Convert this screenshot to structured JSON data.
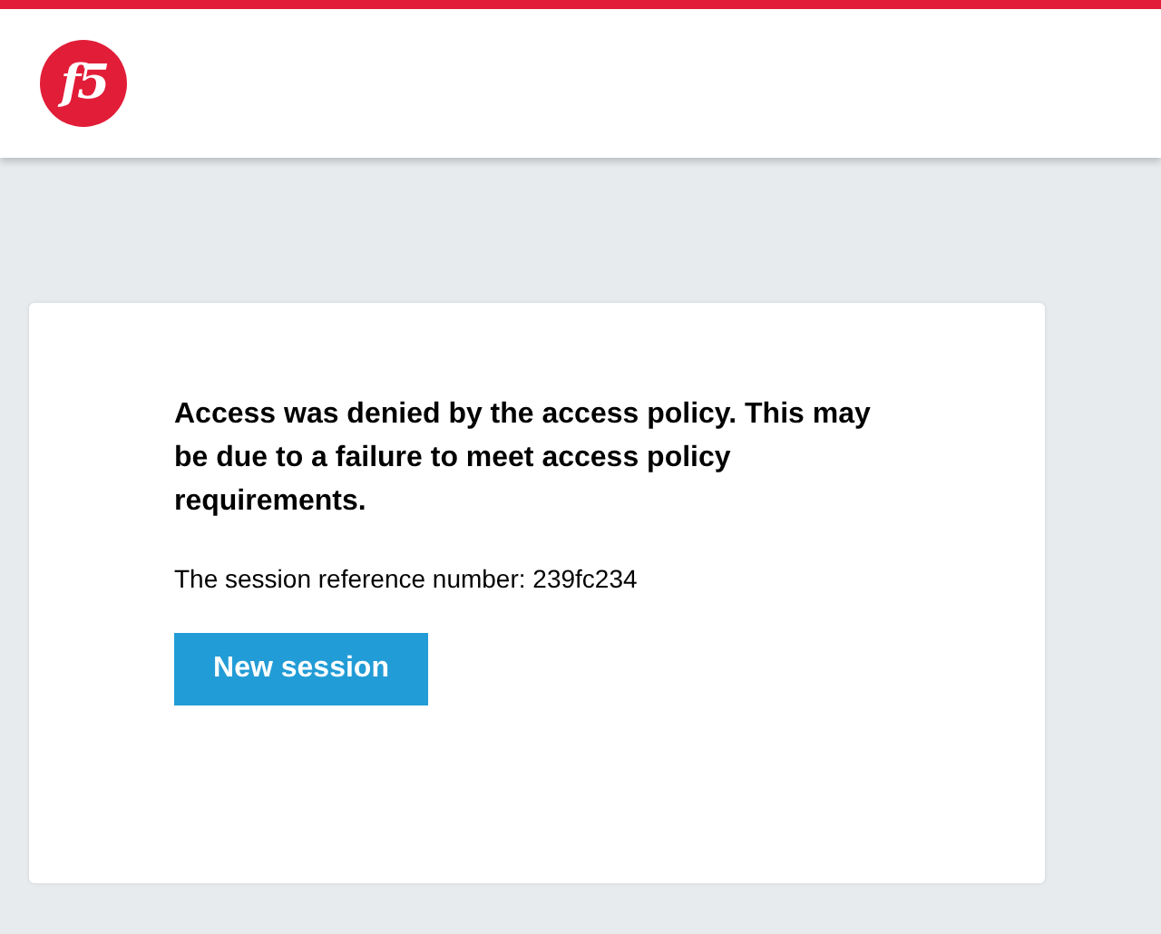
{
  "header": {
    "logo_text": "f5"
  },
  "message": {
    "heading": "Access was denied by the access policy. This may be due to a failure to meet access policy requirements.",
    "session_text": "The session reference number: 239fc234",
    "button": "New session"
  }
}
